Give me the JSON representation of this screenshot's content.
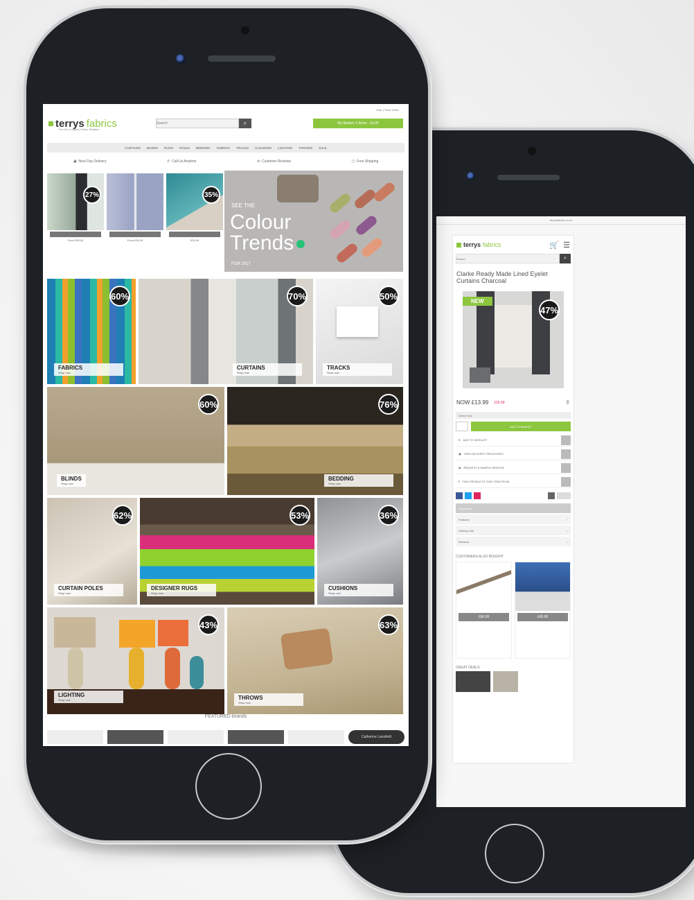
{
  "front_site": {
    "logo": {
      "brand": "terrys",
      "brand_suffix": "fabrics",
      "tagline": "The UK's Largest Online Retailer*"
    },
    "search": {
      "placeholder": "Search",
      "button": "⌕"
    },
    "basket_label": "My Basket: 0 items - £0.00",
    "account_links": "Help  |  Track Order",
    "nav": [
      "CURTAINS",
      "BLINDS",
      "RUGS",
      "POLES",
      "BEDDING",
      "FABRICS",
      "TRACKS",
      "CUSHIONS",
      "LIGHTING",
      "THROWS",
      "SALE"
    ],
    "usps": [
      {
        "icon": "truck-icon",
        "label": "Next Day Delivery"
      },
      {
        "icon": "phone-icon",
        "label": "Call Us Anytime"
      },
      {
        "icon": "chat-icon",
        "label": "Customer Reviews"
      },
      {
        "icon": "box-icon",
        "label": "Free Shipping"
      }
    ],
    "product_cards": [
      {
        "badge": "27%",
        "price": "From £99.00"
      },
      {
        "badge": "",
        "price": "From £30.99"
      },
      {
        "badge": "35%",
        "price": "£25.99"
      }
    ],
    "trend_promo": {
      "line1": "SEE THE",
      "line2": "Colour",
      "line3": "Trends",
      "line4": "FOR 2017"
    },
    "category_tiles": [
      {
        "name": "FABRICS",
        "sub": "Shop now",
        "badge": "60%"
      },
      {
        "name": "CURTAINS",
        "sub": "Shop now",
        "badge": "70%"
      },
      {
        "name": "TRACKS",
        "sub": "Shop now",
        "badge": "50%"
      },
      {
        "name": "BLINDS",
        "sub": "Shop now",
        "badge": "60%"
      },
      {
        "name": "BEDDING",
        "sub": "Shop now",
        "badge": "76%"
      },
      {
        "name": "CURTAIN POLES",
        "sub": "Shop now",
        "badge": "62%"
      },
      {
        "name": "DESIGNER RUGS",
        "sub": "Shop now",
        "badge": "53%"
      },
      {
        "name": "CUSHIONS",
        "sub": "Shop now",
        "badge": "36%"
      },
      {
        "name": "LIGHTING",
        "sub": "Shop now",
        "badge": "43%"
      },
      {
        "name": "THROWS",
        "sub": "Shop now",
        "badge": "63%"
      }
    ],
    "featured_title": "FEATURED brands",
    "brands": [
      "",
      "",
      "",
      "",
      "",
      "Catherine Lansfield"
    ]
  },
  "back_site": {
    "top_text": "terrysfabrics.co.uk",
    "logo": {
      "brand": "terrys",
      "brand_suffix": "fabrics"
    },
    "search_placeholder": "Search",
    "product_title": "Clarke Ready Made Lined Eyelet Curtains Charcoal",
    "new_badge": "NEW",
    "discount_badge": "47%",
    "price": "NOW £13.99",
    "was_price": "£26.99",
    "option_label": "Select Size",
    "add_label": "ADD TO BASKET",
    "links": [
      "ADD TO WISHLIST",
      "VIEW DELIVERY PROCESSES",
      "REQUEST A SAMPLE SERVICE",
      "FIND PRODUCTS THAT ITEM FROM"
    ],
    "accordion": [
      "Description",
      "Features",
      "Delivery Info",
      "Reviews"
    ],
    "related_title": "CUSTOMERS ALSO BOUGHT",
    "related_products": [
      {
        "price": "£66.99"
      },
      {
        "price": "£45.99"
      }
    ],
    "other_title": "GREAT DEALS"
  }
}
